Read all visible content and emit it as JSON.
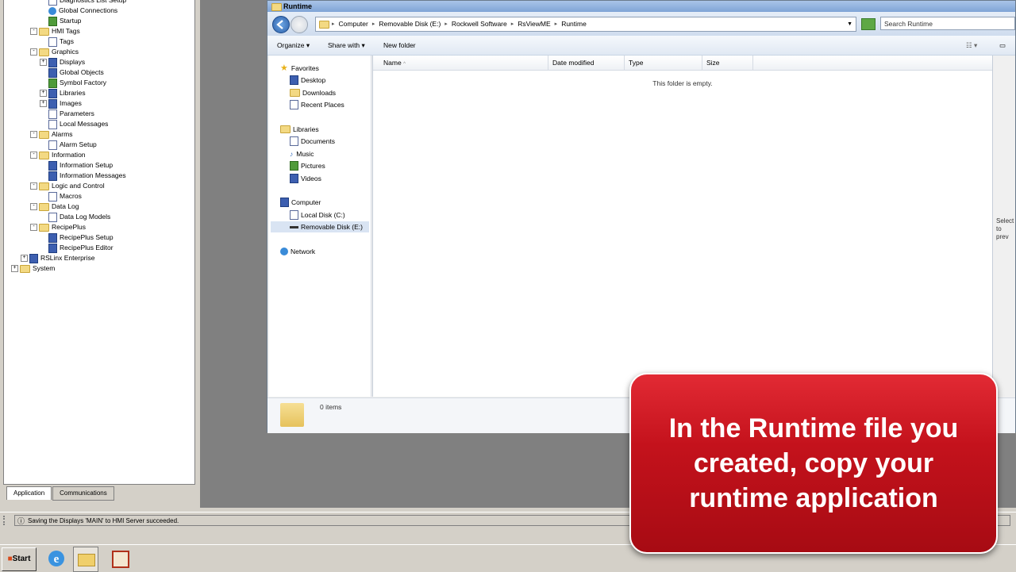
{
  "tree": {
    "items": [
      {
        "label": "Diagnostics List Setup",
        "indent": 3,
        "icon": "doc"
      },
      {
        "label": "Global Connections",
        "indent": 3,
        "icon": "globe"
      },
      {
        "label": "Startup",
        "indent": 3,
        "icon": "green"
      },
      {
        "label": "HMI Tags",
        "indent": 2,
        "icon": "folder",
        "expander": "-"
      },
      {
        "label": "Tags",
        "indent": 3,
        "icon": "doc"
      },
      {
        "label": "Graphics",
        "indent": 2,
        "icon": "folder",
        "expander": "-"
      },
      {
        "label": "Displays",
        "indent": 3,
        "icon": "blue",
        "expander": "+"
      },
      {
        "label": "Global Objects",
        "indent": 3,
        "icon": "blue"
      },
      {
        "label": "Symbol Factory",
        "indent": 3,
        "icon": "green"
      },
      {
        "label": "Libraries",
        "indent": 3,
        "icon": "blue",
        "expander": "+"
      },
      {
        "label": "Images",
        "indent": 3,
        "icon": "blue",
        "expander": "+"
      },
      {
        "label": "Parameters",
        "indent": 3,
        "icon": "doc"
      },
      {
        "label": "Local Messages",
        "indent": 3,
        "icon": "doc"
      },
      {
        "label": "Alarms",
        "indent": 2,
        "icon": "folder",
        "expander": "-"
      },
      {
        "label": "Alarm Setup",
        "indent": 3,
        "icon": "doc"
      },
      {
        "label": "Information",
        "indent": 2,
        "icon": "folder",
        "expander": "-"
      },
      {
        "label": "Information Setup",
        "indent": 3,
        "icon": "blue"
      },
      {
        "label": "Information Messages",
        "indent": 3,
        "icon": "blue"
      },
      {
        "label": "Logic and Control",
        "indent": 2,
        "icon": "folder",
        "expander": "-"
      },
      {
        "label": "Macros",
        "indent": 3,
        "icon": "doc"
      },
      {
        "label": "Data Log",
        "indent": 2,
        "icon": "folder",
        "expander": "-"
      },
      {
        "label": "Data Log Models",
        "indent": 3,
        "icon": "doc"
      },
      {
        "label": "RecipePlus",
        "indent": 2,
        "icon": "folder",
        "expander": "-"
      },
      {
        "label": "RecipePlus Setup",
        "indent": 3,
        "icon": "blue"
      },
      {
        "label": "RecipePlus Editor",
        "indent": 3,
        "icon": "blue"
      },
      {
        "label": "RSLinx Enterprise",
        "indent": 1,
        "icon": "blue",
        "expander": "+"
      },
      {
        "label": "System",
        "indent": 0,
        "icon": "folder",
        "expander": "+"
      }
    ]
  },
  "tabs": [
    {
      "label": "Application",
      "active": true
    },
    {
      "label": "Communications",
      "active": false
    }
  ],
  "window": {
    "title": "Runtime",
    "breadcrumbs": [
      "Computer",
      "Removable Disk (E:)",
      "Rockwell Software",
      "RsViewME",
      "Runtime"
    ],
    "search_placeholder": "Search Runtime",
    "toolbar": {
      "organize": "Organize",
      "share": "Share with",
      "new_folder": "New folder"
    },
    "nav": {
      "favorites": "Favorites",
      "favorites_items": [
        "Desktop",
        "Downloads",
        "Recent Places"
      ],
      "libraries": "Libraries",
      "libraries_items": [
        "Documents",
        "Music",
        "Pictures",
        "Videos"
      ],
      "computer": "Computer",
      "computer_items": [
        "Local Disk (C:)",
        "Removable Disk (E:)"
      ],
      "network": "Network"
    },
    "columns": [
      "Name",
      "Date modified",
      "Type",
      "Size"
    ],
    "empty_message": "This folder is empty.",
    "item_count": "0 items",
    "preview_line1": "Select",
    "preview_line2": "to prev"
  },
  "status_message": "Saving the Displays 'MAIN' to HMI Server succeeded.",
  "taskbar": {
    "start": "Start"
  },
  "callout": {
    "text": "In the Runtime file you created, copy your runtime application",
    "color": "#c4121c"
  }
}
